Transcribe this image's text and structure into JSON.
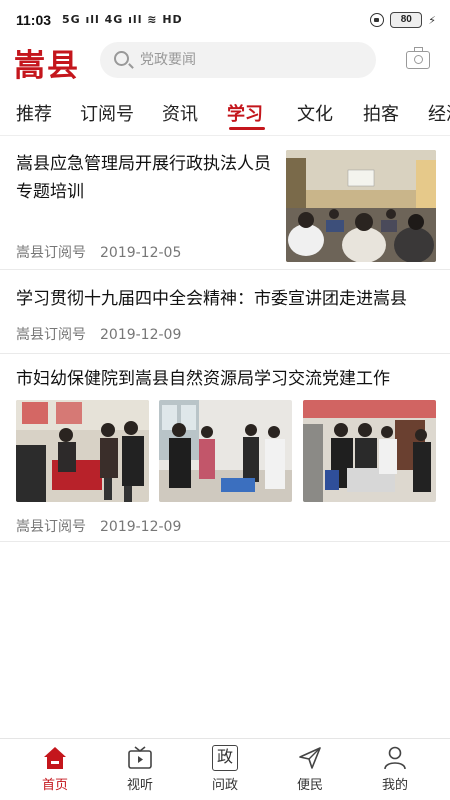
{
  "status_bar": {
    "time": "11:03",
    "signal_text": "5G ıll 4G ıll ≋ HD",
    "battery": "80"
  },
  "header": {
    "logo": "嵩县",
    "search_placeholder": "党政要闻",
    "icons": [
      "search-icon",
      "camera-icon"
    ]
  },
  "tabs": [
    {
      "label": "推荐"
    },
    {
      "label": "订阅号"
    },
    {
      "label": "资讯"
    },
    {
      "label": "学习",
      "active": true
    },
    {
      "label": "文化"
    },
    {
      "label": "拍客"
    },
    {
      "label": "经济"
    }
  ],
  "articles": [
    {
      "title": "嵩县应急管理局开展行政执法人员专题培训",
      "source": "嵩县订阅号",
      "date": "2019-12-05"
    },
    {
      "title": "学习贯彻十九届四中全会精神：市委宣讲团走进嵩县",
      "source": "嵩县订阅号",
      "date": "2019-12-09"
    },
    {
      "title": "市妇幼保健院到嵩县自然资源局学习交流党建工作",
      "source": "嵩县订阅号",
      "date": "2019-12-09"
    }
  ],
  "bottom_nav": [
    {
      "label": "首页",
      "icon": "home-icon",
      "active": true
    },
    {
      "label": "视听",
      "icon": "tv-icon"
    },
    {
      "label": "问政",
      "icon": "zheng-icon",
      "glyph": "政"
    },
    {
      "label": "便民",
      "icon": "send-icon"
    },
    {
      "label": "我的",
      "icon": "user-icon"
    }
  ],
  "colors": {
    "brand_red": "#c4161c",
    "text_dark": "#111111",
    "meta_gray": "#777777"
  }
}
